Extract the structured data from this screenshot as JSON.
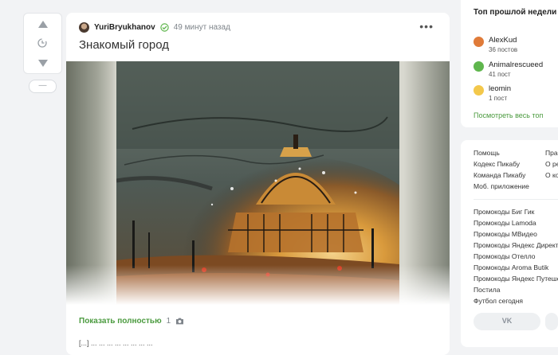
{
  "post": {
    "author": "YuriBryukhanov",
    "time": "49 минут назад",
    "title": "Знакомый город",
    "show_more": "Показать полностью",
    "photo_count": "1",
    "body_preview": "[...] ...  ...  ...  ...  ...  ...  ...  ..."
  },
  "vote": {
    "collapse_label": "—"
  },
  "top_week": {
    "title": "Топ прошлой недели",
    "users": [
      {
        "name": "AlexKud",
        "posts": "36 постов",
        "avatar_color": "#e07b39"
      },
      {
        "name": "Animalrescueed",
        "posts": "41 пост",
        "avatar_color": "#5fb64d"
      },
      {
        "name": "leomin",
        "posts": "1 пост",
        "avatar_color": "#f3c84b"
      }
    ],
    "see_all": "Посмотреть весь топ"
  },
  "footer": {
    "col1": [
      "Помощь",
      "Кодекс Пикабу",
      "Команда Пикабу",
      "Моб. приложение"
    ],
    "col2": [
      "Пра",
      "О ре",
      "О ко"
    ],
    "promos": [
      "Промокоды Биг Гик",
      "Промокоды Lamoda",
      "Промокоды МВидео",
      "Промокоды Яндекс Директ",
      "Промокоды Отелло",
      "Промокоды Aroma Butik",
      "Промокоды Яндекс Путешествия",
      "Постила",
      "Футбол сегодня"
    ],
    "vk": "VK"
  },
  "colors": {
    "accent": "#4a9a3e",
    "background": "#f2f3f5"
  }
}
